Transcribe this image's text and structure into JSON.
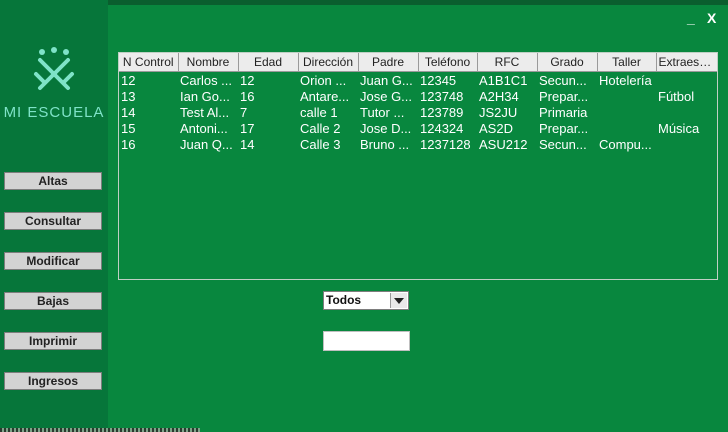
{
  "app": {
    "logo_text": "MI ESCUELA"
  },
  "window": {
    "minimize_label": "_",
    "close_label": "X"
  },
  "sidebar": {
    "buttons": [
      {
        "label": "Altas"
      },
      {
        "label": "Consultar"
      },
      {
        "label": "Modificar"
      },
      {
        "label": "Bajas"
      },
      {
        "label": "Imprimir"
      },
      {
        "label": "Ingresos"
      }
    ]
  },
  "table": {
    "columns": [
      "N Control",
      "Nombre",
      "Edad",
      "Dirección",
      "Padre",
      "Teléfono",
      "RFC",
      "Grado",
      "Taller",
      "Extraesc..."
    ],
    "rows": [
      [
        "12",
        "Carlos ...",
        "12",
        "Orion ...",
        "Juan G...",
        "12345",
        "A1B1C1",
        "Secun...",
        "Hotelería",
        ""
      ],
      [
        "13",
        "Ian Go...",
        "16",
        "Antare...",
        "Jose G...",
        "123748",
        "A2H34",
        "Prepar...",
        "",
        "Fútbol"
      ],
      [
        "14",
        "Test Al...",
        "7",
        "calle 1",
        "Tutor ...",
        "123789",
        "JS2JU",
        "Primaria",
        "",
        ""
      ],
      [
        "15",
        "Antoni...",
        "17",
        "Calle 2",
        "Jose D...",
        "124324",
        "AS2D",
        "Prepar...",
        "",
        "Música"
      ],
      [
        "16",
        "Juan Q...",
        "14",
        "Calle 3",
        "Bruno ...",
        "1237128",
        "ASU212",
        "Secun...",
        "Compu...",
        ""
      ]
    ]
  },
  "filter": {
    "selected": "Todos"
  },
  "search": {
    "value": "",
    "placeholder": ""
  },
  "colors": {
    "background": "#08873e",
    "sidebar": "#06763a",
    "logo": "#7fe3c8"
  }
}
